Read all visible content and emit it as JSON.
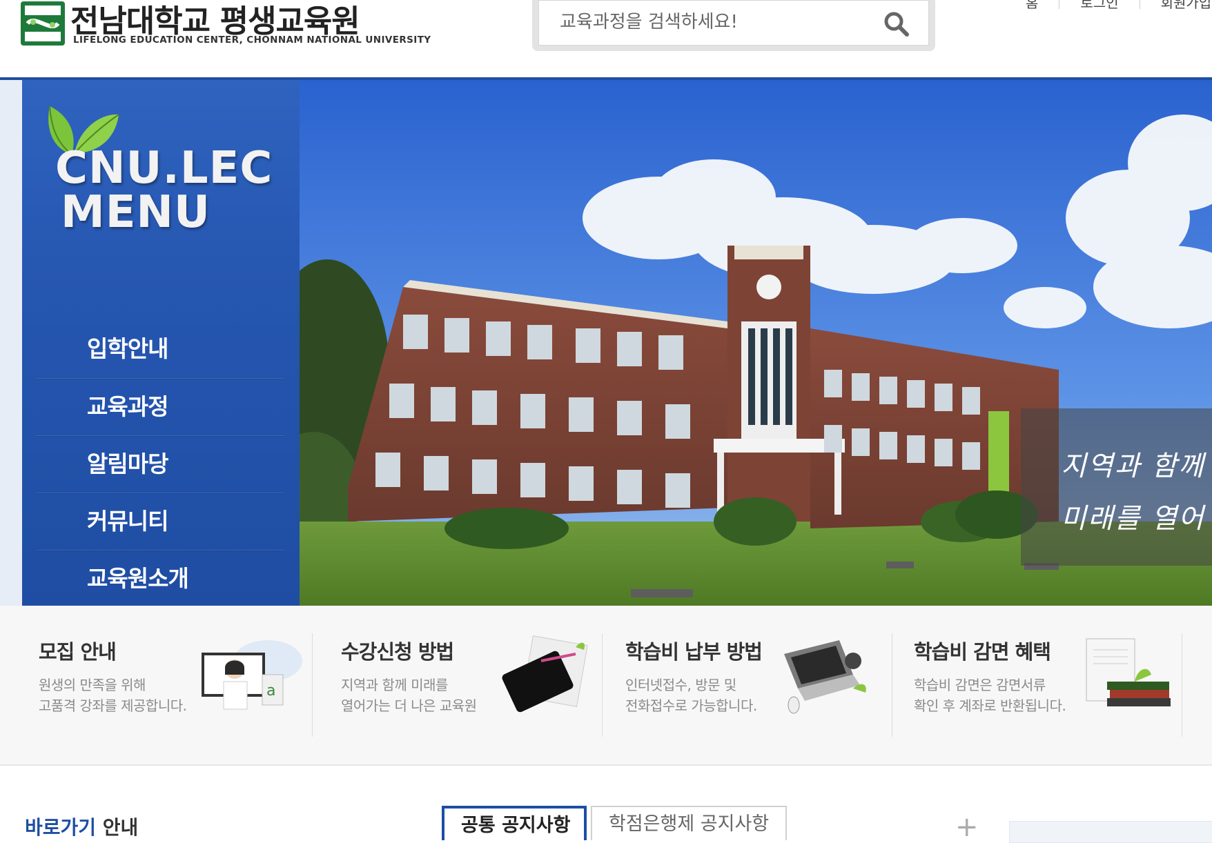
{
  "header": {
    "logo_ko": "전남대학교 평생교육원",
    "logo_en": "LIFELONG EDUCATION CENTER, CHONNAM NATIONAL UNIVERSITY",
    "search_placeholder": "교육과정을 검색하세요!",
    "util_links": [
      "홈",
      "로그인",
      "회원가입"
    ]
  },
  "side_menu": {
    "title_line1": "CNU.LEC",
    "title_line2": "MENU",
    "items": [
      "입학안내",
      "교육과정",
      "알림마당",
      "커뮤니티",
      "교육원소개"
    ]
  },
  "hero": {
    "slogan_line1": "지역과 함께",
    "slogan_line2": "미래를 열어"
  },
  "quick_links": [
    {
      "title": "모집 안내",
      "desc1": "원생의 만족을 위해",
      "desc2": "고품격 강좌를 제공합니다.",
      "icon": "teacher-icon"
    },
    {
      "title": "수강신청 방법",
      "desc1": "지역과 함께 미래를",
      "desc2": "열어가는 더 나은 교육원",
      "icon": "tablet-icon"
    },
    {
      "title": "학습비 납부 방법",
      "desc1": "인터넷접수, 방문 및",
      "desc2": "전화접수로 가능합니다.",
      "icon": "laptop-icon"
    },
    {
      "title": "학습비 감면 혜택",
      "desc1": "학습비 감면은 감면서류",
      "desc2": "확인 후 계좌로 반환됩니다.",
      "icon": "books-icon"
    }
  ],
  "bottom": {
    "shortcut_highlight": "바로가기",
    "shortcut_rest": " 안내",
    "tabs": [
      "공통 공지사항",
      "학점은행제 공지사항"
    ],
    "more": "+"
  },
  "colors": {
    "brand_blue": "#1d4fa3",
    "menu_bg": "#2556b0",
    "sky": "#2f6cd4"
  }
}
